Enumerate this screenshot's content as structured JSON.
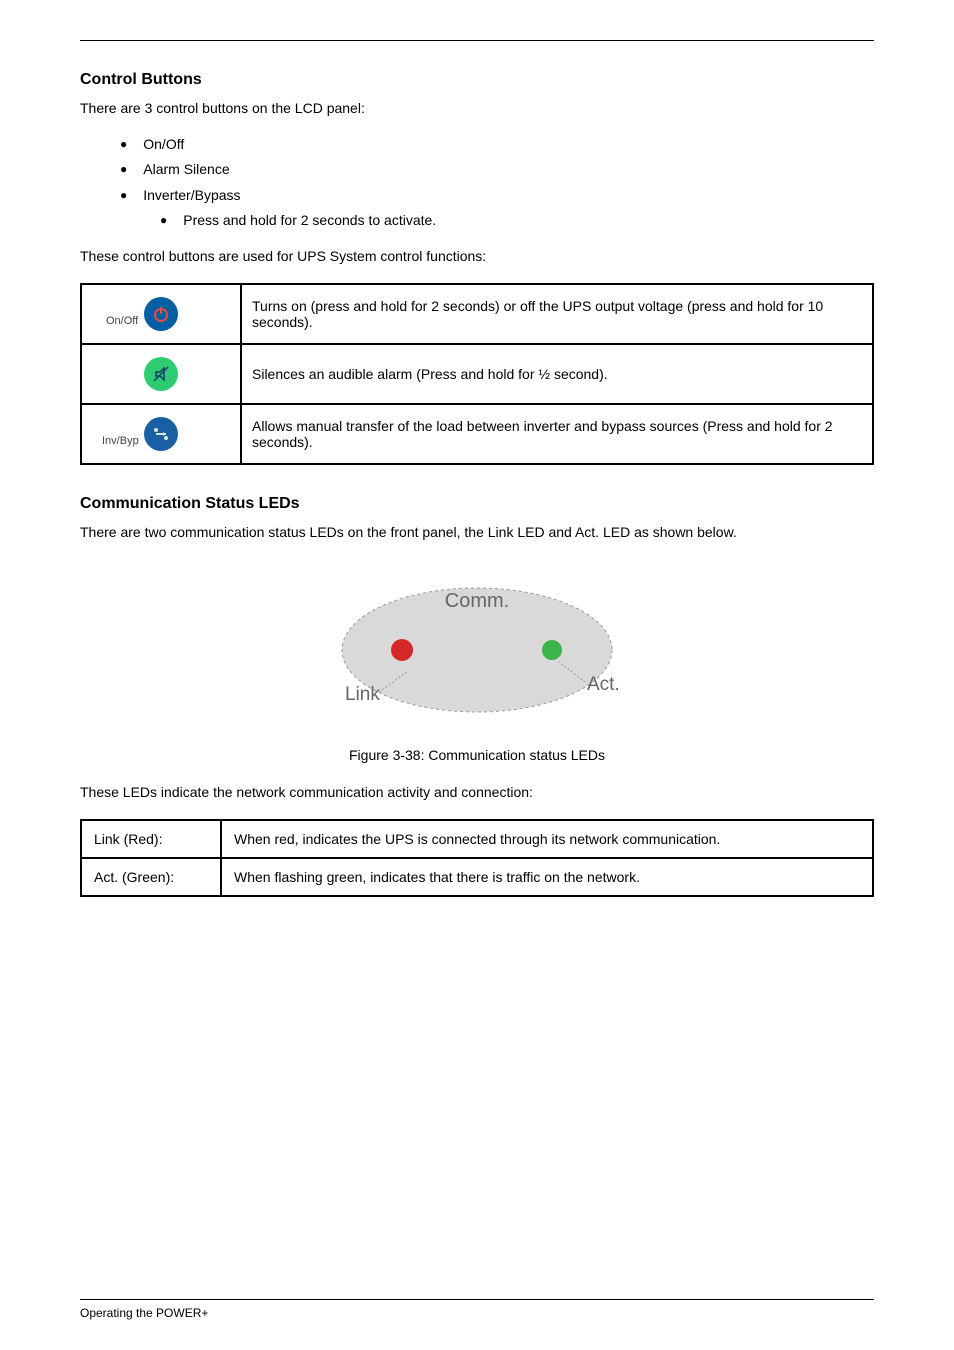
{
  "section1": {
    "title": "Control Buttons",
    "intro1": "There are 3 control buttons on the LCD panel:",
    "b1": "On/Off",
    "b2": "Alarm Silence",
    "b3": "Inverter/Bypass",
    "b3sub": "Press and hold for 2 seconds to activate.",
    "intro2": "These control buttons are used for UPS System control functions:",
    "t1": "Turns on (press and hold for 2 seconds) or off the UPS output voltage (press and hold for 10 seconds).",
    "t2": "Silences an audible alarm (Press and hold for ½ second).",
    "t3": "Allows manual transfer of the load between inverter and bypass sources (Press and hold for 2 seconds)."
  },
  "labels": {
    "onoff": "On/Off",
    "invbyp": "Inv/Byp"
  },
  "section2": {
    "title": "Communication Status LEDs",
    "p1": "There are two communication status LEDs on the front panel, the Link LED and Act. LED as shown below.",
    "caption": "Figure 3-38: Communication status LEDs",
    "p2": "These LEDs indicate the network communication activity and connection:",
    "led1name": "Link (Red):",
    "led1desc": "When red, indicates the UPS is connected through its network communication.",
    "led2name": "Act. (Green):",
    "led2desc": "When flashing green, indicates that there is traffic on the network."
  },
  "ellipse": {
    "comm": "Comm.",
    "link": "Link",
    "act": "Act."
  },
  "footer": "Operating the POWER+"
}
